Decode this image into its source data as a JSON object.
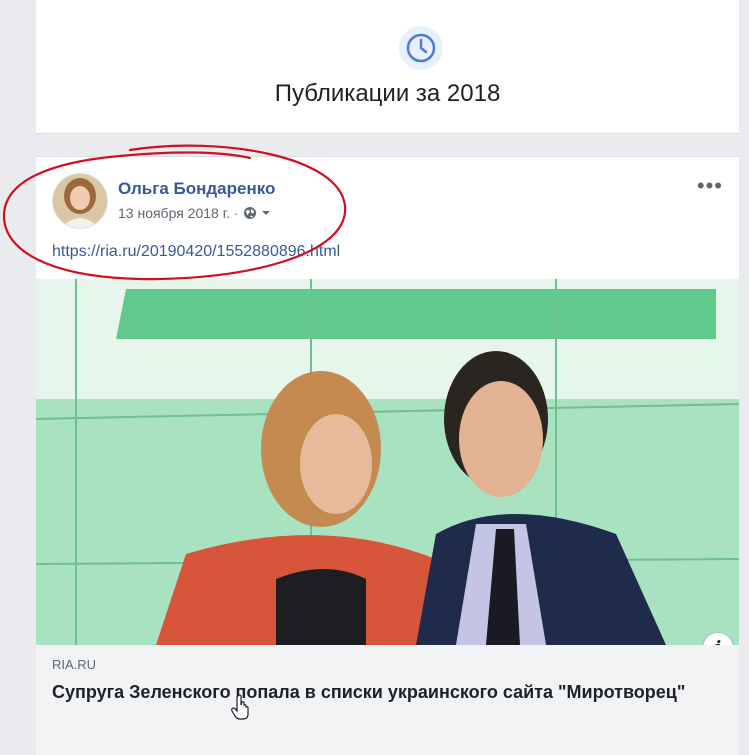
{
  "year_section": {
    "icon": "clock-icon",
    "title": "Публикации за 2018"
  },
  "post": {
    "author": "Ольга Бондаренко",
    "date": "13 ноября 2018 г. ·",
    "audience_icon": "globe-icon",
    "more_label": "•••",
    "link": "https://ria.ru/20190420/1552880896.html",
    "preview": {
      "source": "RIA.RU",
      "headline": "Супруга Зеленского попала в списки украинского сайта \"Миротворец\"",
      "info_label": "i"
    }
  },
  "colors": {
    "link_blue": "#385898",
    "annotation_red": "#d01020",
    "preview_green": "#9cd9b6"
  }
}
